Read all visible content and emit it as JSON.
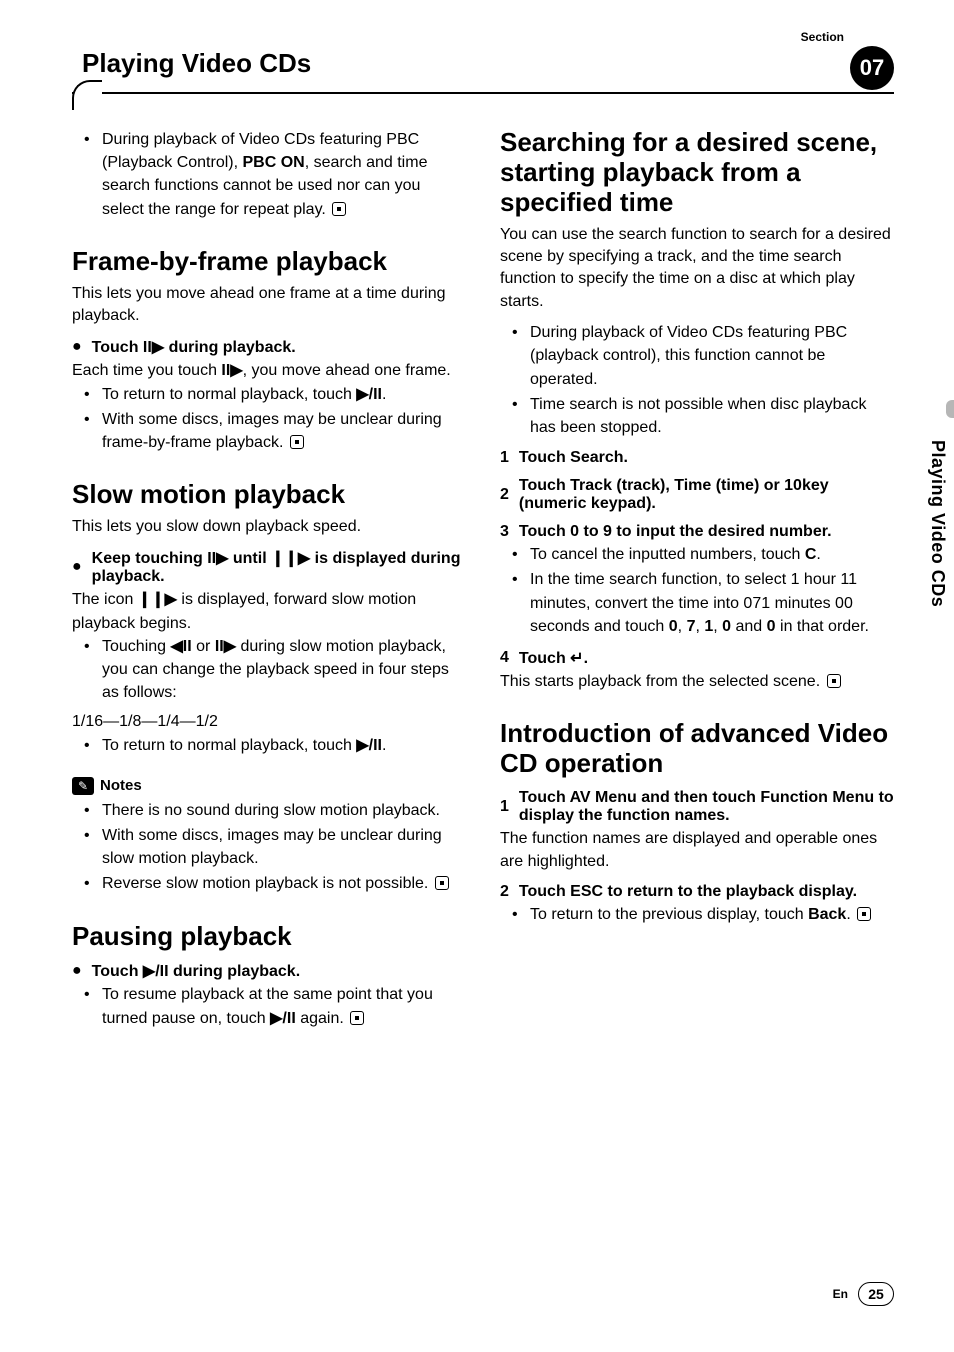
{
  "header": {
    "section_label": "Section",
    "badge": "07",
    "title": "Playing Video CDs"
  },
  "side_tab": "Playing Video CDs",
  "left": {
    "top_bullet": "During playback of Video CDs featuring PBC (Playback Control), PBC ON, search and time search functions cannot be used nor can you select the range for repeat play.",
    "h_frame": "Frame-by-frame playback",
    "frame_intro": "This lets you move ahead one frame at a time during playback.",
    "frame_step_label": "Touch r during playing.",
    "frame_step_body": "Each time you touch r, you move ahead one frame.",
    "frame_notes": [
      "To return to normal playback, touch f/g.",
      "With some discs, images may be unclear during frame-by-frame playback."
    ],
    "h_slow": "Slow motion playback",
    "slow_intro": "This lets you slow down playback speed.",
    "slow_step_label": "Keep touching r until q is displayed during playback.",
    "slow_step_body": "The icon q is displayed, forward slow motion playback begins.",
    "slow_change": "Touching p or r during slow motion playback, you can change the playback speed in four steps as follows:",
    "slow_speeds": "1/16—1/8—1/4—1/2",
    "slow_return": "To return to normal playback, touch f/g.",
    "notes_title": "Notes",
    "notes_list": [
      "There is no sound during slow motion playback.",
      "With some discs, images may be unclear during slow motion playback.",
      "Reverse slow motion playback is not possible."
    ],
    "h_pause": "Pausing playback",
    "pause_step_label": "Touch f/g during playback.",
    "pause_return": "To resume playback at the same point that you turned pause on, touch f/g again."
  },
  "right": {
    "h_search": "Searching for a desired scene, starting playback from a specified time",
    "search_intro": "You can use the search function to search for a desired scene by specifying a track, and the time search function to specify the time on a disc at which play starts.",
    "search_bullets": [
      "During playback of Video CDs featuring PBC (playback control), this function cannot be operated.",
      "Time search is not possible when disc playback has been stopped."
    ],
    "step1": {
      "num": "1",
      "label": "Touch Search."
    },
    "step2": {
      "num": "2",
      "label": "Touch Track (track), Time (time) or 10key (numeric keypad)."
    },
    "step3": {
      "num": "3",
      "label": "Touch 0 to 9 to input the desired number."
    },
    "step3_notes": [
      "To cancel the inputted numbers, touch C.",
      "In the time search function, to select 1 hour 11 minutes, convert the time into 071 minutes 00 seconds and touch 0, 7, 1, 0 and 0 in that order."
    ],
    "step4": {
      "num": "4",
      "label": "Touch ↵."
    },
    "step4_body": "This starts playback from the selected scene.",
    "h_adv": "Introduction of advanced Video CD operation",
    "adv_step1": {
      "num": "1",
      "label": "Touch AV Menu and then touch Function Menu to display the function names."
    },
    "adv_step1_body": "The function names are displayed and operable ones are highlighted.",
    "adv_step2": {
      "num": "2",
      "label": "Touch ESC to return to the playback display."
    },
    "adv_return": "To return to the previous display, touch Back."
  },
  "footer": {
    "lang": "En",
    "page": "25"
  }
}
